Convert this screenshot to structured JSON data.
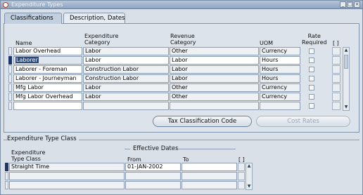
{
  "window": {
    "title": "Expenditure Types",
    "controls": [
      "_",
      "□",
      "×"
    ]
  },
  "tabs": [
    {
      "label": "Classifications",
      "active": true
    },
    {
      "label": "Description, Dates",
      "active": false
    }
  ],
  "grid": {
    "headers": {
      "name": "Name",
      "category": "Expenditure\nCategory",
      "revenue": "Revenue\nCategory",
      "uom": "UOM",
      "rate": "Rate\nRequired",
      "df": "[ ]"
    },
    "rows": [
      {
        "name": "Labor Overhead",
        "category": "Labor",
        "revenue": "Other",
        "uom": "Currency",
        "current": false
      },
      {
        "name": "Laborer",
        "category": "Labor",
        "revenue": "Labor",
        "uom": "Hours",
        "current": true
      },
      {
        "name": "Laborer - Foreman",
        "category": "Construction Labor",
        "revenue": "Labor",
        "uom": "Hours",
        "current": false
      },
      {
        "name": "Laborer - Journeyman",
        "category": "Construction Labor",
        "revenue": "Labor",
        "uom": "Hours",
        "current": false
      },
      {
        "name": "Mfg Labor",
        "category": "Labor",
        "revenue": "Other",
        "uom": "Currency",
        "current": false
      },
      {
        "name": "Mfg Labor Overhead",
        "category": "Labor",
        "revenue": "Other",
        "uom": "Currency",
        "current": false
      },
      {
        "name": "",
        "category": "",
        "revenue": "",
        "uom": "",
        "current": false
      }
    ]
  },
  "buttons": {
    "tax": "Tax Classification Code",
    "cost_rates": "Cost Rates"
  },
  "type_class": {
    "group_label": "Expenditure Type Class",
    "effective_dates_label": "Effective Dates",
    "headers": {
      "class": "Expenditure\nType Class",
      "from": "From",
      "to": "To",
      "df": "[ ]"
    },
    "rows": [
      {
        "class": "Straight Time",
        "from": "01-JAN-2002",
        "to": "",
        "current": true
      },
      {
        "class": "",
        "from": "",
        "to": "",
        "current": false
      },
      {
        "class": "",
        "from": "",
        "to": "",
        "current": false
      }
    ]
  },
  "colors": {
    "title_bar": "#8ea4c1",
    "current_record": "#1d3568",
    "highlight": "#2d4a7a"
  }
}
